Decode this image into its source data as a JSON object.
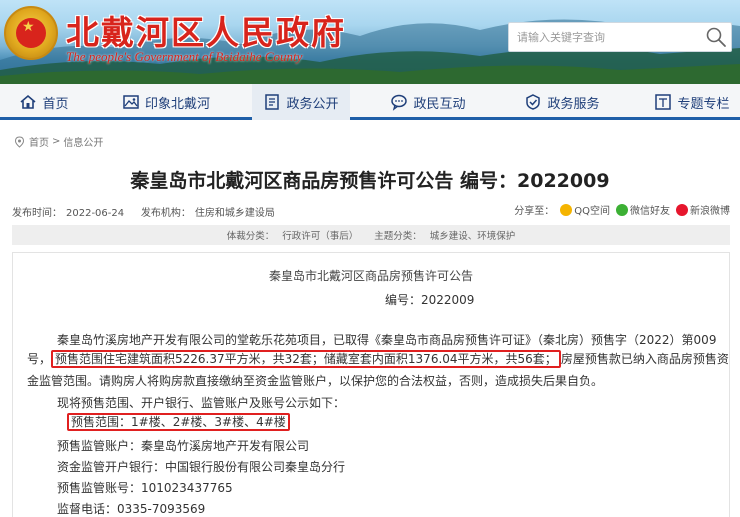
{
  "header": {
    "title": "北戴河区人民政府",
    "subtitle": "The people's Government of Beidaihe County",
    "search_placeholder": "请输入关键字查询",
    "emblem_icon": "national-emblem-icon"
  },
  "nav": {
    "items": [
      {
        "label": "首页",
        "icon": "home-icon"
      },
      {
        "label": "印象北戴河",
        "icon": "image-icon"
      },
      {
        "label": "政务公开",
        "icon": "document-icon"
      },
      {
        "label": "政民互动",
        "icon": "chat-icon"
      },
      {
        "label": "政务服务",
        "icon": "service-icon"
      },
      {
        "label": "专题专栏",
        "icon": "column-icon"
      }
    ],
    "active_index": 2
  },
  "breadcrumb": {
    "home": "首页",
    "separator": ">",
    "current": "信息公开"
  },
  "article": {
    "title": "秦皇岛市北戴河区商品房预售许可公告 编号：2022009",
    "publish_label": "发布时间：",
    "publish_date": "2022-06-24",
    "org_label": "发布机构：",
    "org": "住房和城乡建设局",
    "share_label": "分享至：",
    "share": {
      "qq": "QQ空间",
      "wechat": "微信好友",
      "weibo": "新浪微博"
    },
    "category": {
      "topic_label": "体裁分类：",
      "topic": "行政许可（事后）",
      "theme_label": "主题分类：",
      "theme": "城乡建设、环境保护"
    }
  },
  "document": {
    "heading": "秦皇岛市北戴河区商品房预售许可公告",
    "number": "编号：2022009",
    "para1_line1": "秦皇岛竹溪房地产开发有限公司的堂乾乐花苑项目，已取得《秦皇岛市商品房预售许可证》（秦北房）预售字（2022）第009",
    "para1_line2_a": "号，",
    "para1_line2_b": "预售范围住宅建筑面积5226.37平方米，共32套；储藏室套内面积1376.04平方米，共56套；",
    "para1_line2_c": "房屋预售款已纳入商品房预售资",
    "para1_line3": "金监管范围。请购房人将购房款直接缴纳至资金监管账户，以保护您的合法权益，否则，造成损失后果自负。",
    "para2": "现将预售范围、开户银行、监管账户及账号公示如下：",
    "scope": "预售范围：1#楼、2#楼、3#楼、4#楼",
    "account": "预售监管账户：秦皇岛竹溪房地产开发有限公司",
    "bank": "资金监管开户银行：中国银行股份有限公司秦皇岛分行",
    "account_no": "预售监管账号：101023437765",
    "phone": "监督电话：0335-7093569"
  },
  "colors": {
    "brand_red": "#d8241c",
    "nav_text": "#1f3f7a",
    "nav_underline": "#1f5fa8",
    "highlight_border": "#e02020"
  }
}
